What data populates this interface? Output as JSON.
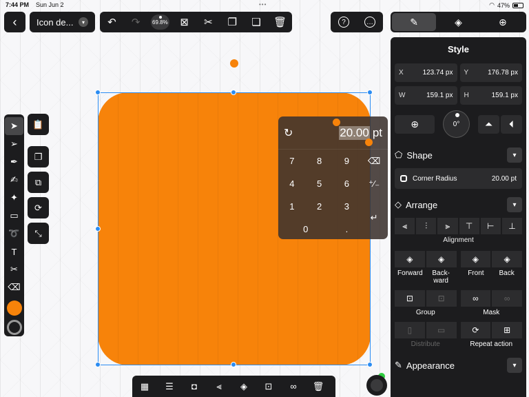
{
  "status": {
    "time": "7:44 PM",
    "date": "Sun Jun 2",
    "battery": "47%"
  },
  "header": {
    "doc_title": "Icon de...",
    "zoom": "69.8%"
  },
  "panel": {
    "title": "Style",
    "x_label": "X",
    "x_value": "123.74 px",
    "y_label": "Y",
    "y_value": "176.78 px",
    "w_label": "W",
    "w_value": "159.1 px",
    "h_label": "H",
    "h_value": "159.1 px",
    "rotation": "0°",
    "shape_title": "Shape",
    "corner_label": "Corner Radius",
    "corner_value": "20.00 pt",
    "arrange_title": "Arrange",
    "alignment_label": "Alignment",
    "forward": "Forward",
    "backward": "Back-\nward",
    "front": "Front",
    "back": "Back",
    "group": "Group",
    "mask": "Mask",
    "distribute": "Distribute",
    "repeat_action": "Repeat action",
    "appearance_title": "Appearance"
  },
  "keypad": {
    "value": "20.00",
    "unit": "pt",
    "keys": [
      "7",
      "8",
      "9",
      "4",
      "5",
      "6",
      "1",
      "2",
      "3",
      "0",
      "."
    ]
  },
  "colors": {
    "fill": "#f7830a",
    "selection": "#2b8cf2"
  }
}
